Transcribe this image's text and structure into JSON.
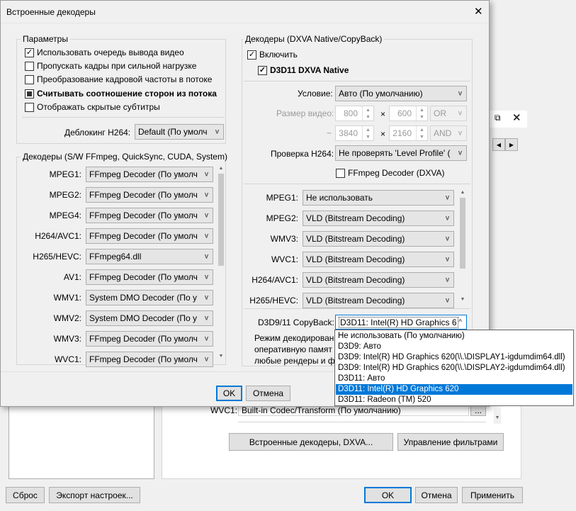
{
  "dialog": {
    "title": "Встроенные декодеры",
    "params": {
      "legend": "Параметры",
      "options": [
        {
          "label": "Использовать очередь вывода видео",
          "checked": true
        },
        {
          "label": "Пропускать кадры при сильной нагрузке",
          "checked": false
        },
        {
          "label": "Преобразование кадровой частоты в потоке",
          "checked": false
        },
        {
          "label": "Считывать соотношение сторон из потока",
          "checked": "partial"
        },
        {
          "label": "Отображать скрытые субтитры",
          "checked": false
        }
      ],
      "deblock_label": "Деблокинг H264:",
      "deblock_value": "Default (По умолч"
    },
    "sw_decoders": {
      "legend": "Декодеры (S/W FFmpeg, QuickSync, CUDA, System)",
      "rows": [
        {
          "label": "MPEG1:",
          "value": "FFmpeg Decoder (По умолч"
        },
        {
          "label": "MPEG2:",
          "value": "FFmpeg Decoder (По умолч"
        },
        {
          "label": "MPEG4:",
          "value": "FFmpeg Decoder (По умолч"
        },
        {
          "label": "H264/AVC1:",
          "value": "FFmpeg Decoder (По умолч"
        },
        {
          "label": "H265/HEVC:",
          "value": "FFmpeg64.dll"
        },
        {
          "label": "AV1:",
          "value": "FFmpeg Decoder (По умолч"
        },
        {
          "label": "WMV1:",
          "value": "System DMO Decoder (По у"
        },
        {
          "label": "WMV2:",
          "value": "System DMO Decoder (По у"
        },
        {
          "label": "WMV3:",
          "value": "FFmpeg Decoder (По умолч"
        },
        {
          "label": "WVC1:",
          "value": "FFmpeg Decoder (По умолч"
        }
      ]
    },
    "dxva": {
      "legend": "Декодеры (DXVA Native/CopyBack)",
      "enable_label": "Включить",
      "d3d11_label": "D3D11 DXVA Native",
      "condition_label": "Условие:",
      "condition_value": "Авто (По умолчанию)",
      "size_label": "Размер видео:",
      "w1": "800",
      "h1": "600",
      "op1": "OR",
      "tilde": "~",
      "w2": "3840",
      "h2": "2160",
      "op2": "AND",
      "times": "×",
      "check_label": "Проверка H264:",
      "check_value": "Не проверять 'Level Profile' (",
      "ffmpeg_dxva_label": "FFmpeg Decoder (DXVA)",
      "rows": [
        {
          "label": "MPEG1:",
          "value": "Не использовать"
        },
        {
          "label": "MPEG2:",
          "value": "VLD (Bitstream Decoding)"
        },
        {
          "label": "WMV3:",
          "value": "VLD (Bitstream Decoding)"
        },
        {
          "label": "WVC1:",
          "value": "VLD (Bitstream Decoding)"
        },
        {
          "label": "H264/AVC1:",
          "value": "VLD (Bitstream Decoding)"
        },
        {
          "label": "H265/HEVC:",
          "value": "VLD (Bitstream Decoding)"
        }
      ],
      "copyback_label": "D3D9/11 CopyBack:",
      "copyback_value": "D3D11: Intel(R) HD Graphics 6",
      "info_line1": "Режим декодирован",
      "info_line2": "оперативную памят",
      "info_line3": "любые рендеры и фи"
    },
    "ok": "OK",
    "cancel": "Отмена"
  },
  "dropdown": {
    "items": [
      "Не использовать (По умолчанию)",
      "D3D9: Авто",
      "D3D9: Intel(R) HD Graphics 620(\\\\.\\DISPLAY1-igdumdim64.dll)",
      "D3D9: Intel(R) HD Graphics 620(\\\\.\\DISPLAY2-igdumdim64.dll)",
      "D3D11: Авто",
      "D3D11: Intel(R) HD Graphics 620",
      "D3D11: Radeon (TM) 520"
    ],
    "selected_index": 5
  },
  "background": {
    "wvc1_label": "WVC1:",
    "wvc1_value": "Built-in Codec/Transform (По умолчанию)",
    "dots": "...",
    "builtin_button": "Встроенные декодеры, DXVA...",
    "filters_button": "Управление фильтрами",
    "reset": "Сброс",
    "export": "Экспорт настроек...",
    "ok": "OK",
    "cancel": "Отмена",
    "apply": "Применить"
  }
}
